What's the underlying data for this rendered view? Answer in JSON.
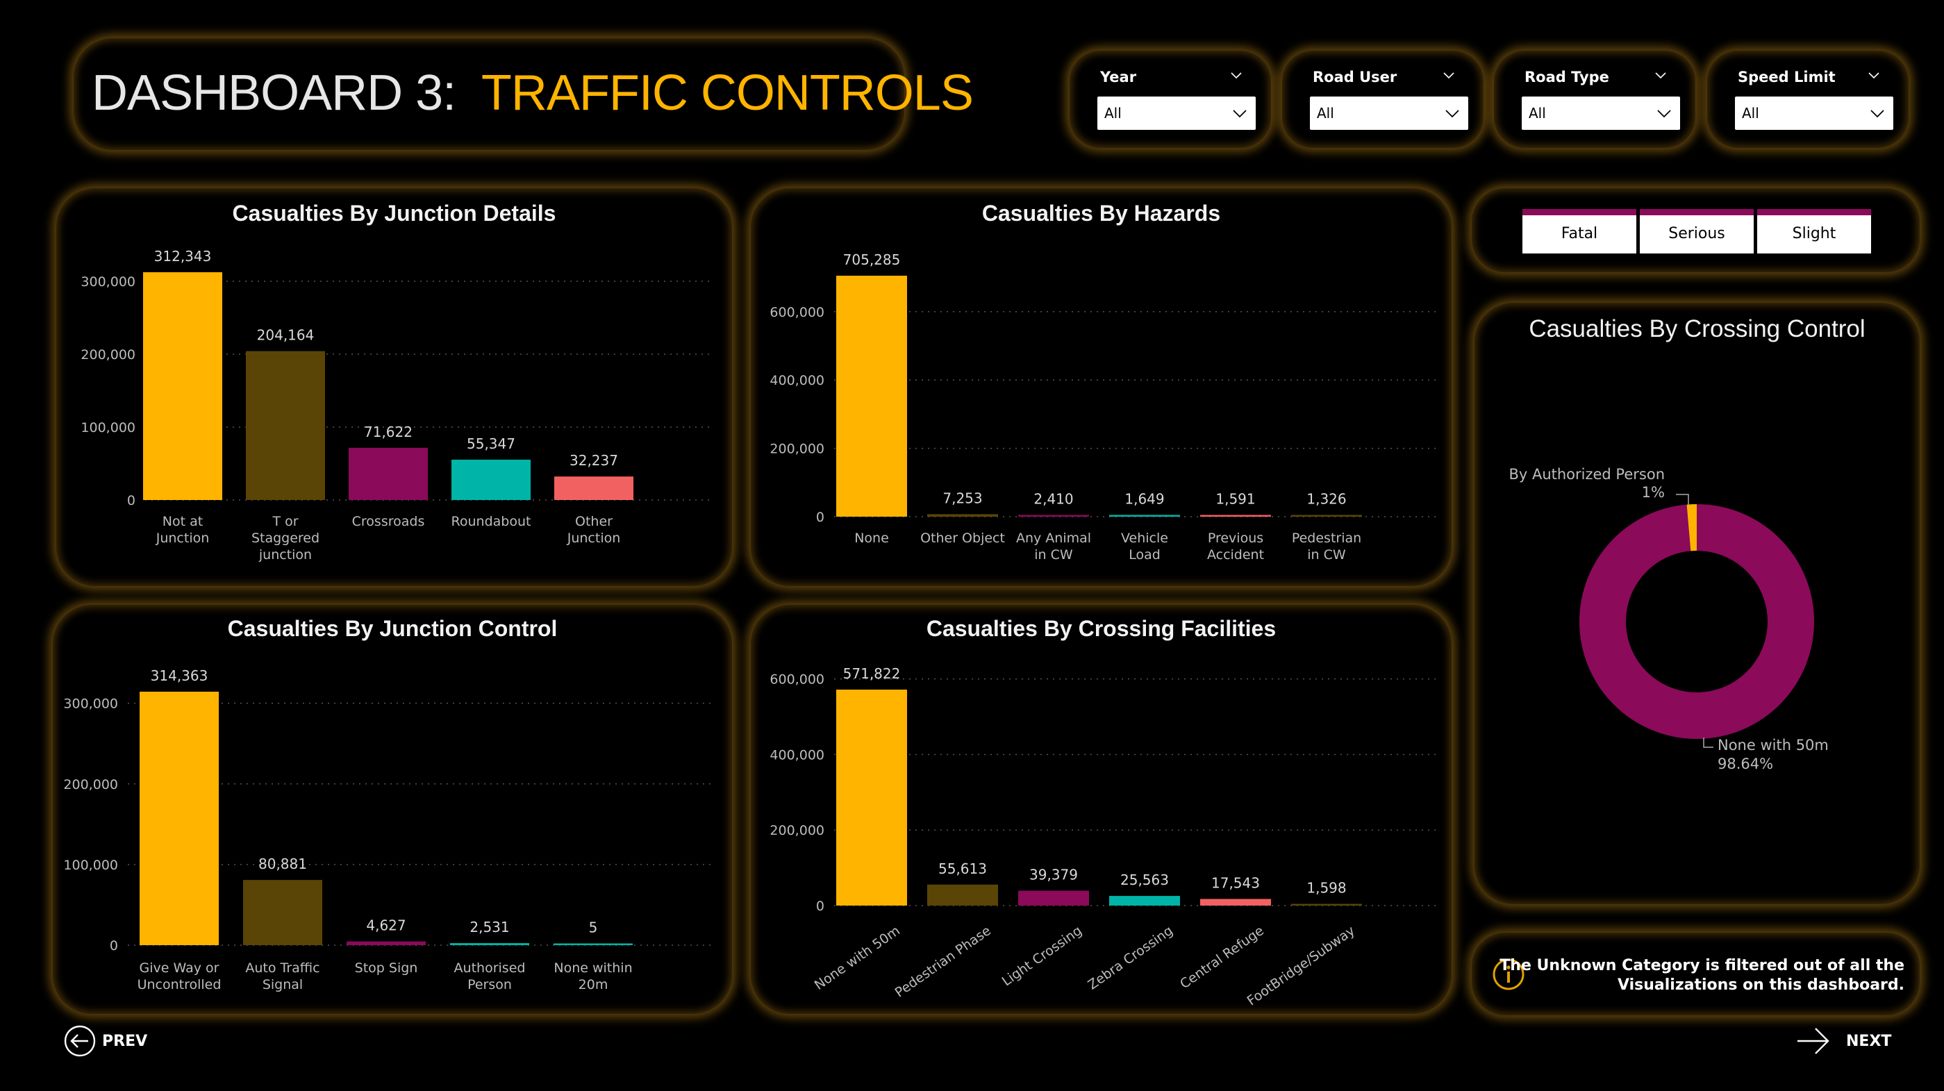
{
  "header": {
    "title_prefix": "DASHBOARD 3:",
    "title_main": "TRAFFIC CONTROLS"
  },
  "filters": [
    {
      "label": "Year",
      "value": "All"
    },
    {
      "label": "Road User",
      "value": "All"
    },
    {
      "label": "Road Type",
      "value": "All"
    },
    {
      "label": "Speed Limit",
      "value": "All"
    }
  ],
  "severity_buttons": [
    "Fatal",
    "Serious",
    "Slight"
  ],
  "info": {
    "line1": "The Unknown Category is filtered out of all the",
    "line2": "Visualizations on this dashboard."
  },
  "nav": {
    "prev": "PREV",
    "next": "NEXT"
  },
  "colors": {
    "yellow": "#ffb400",
    "brown": "#5a4406",
    "magenta": "#8b0a5a",
    "teal": "#00b5a7",
    "salmon": "#f26161",
    "accent_glow": "#aa7814"
  },
  "chart_data": [
    {
      "type": "bar",
      "title": "Casualties By Junction Details",
      "categories": [
        [
          "Not at",
          "Junction"
        ],
        [
          "T or",
          "Staggered",
          "junction"
        ],
        [
          "Crossroads"
        ],
        [
          "Roundabout"
        ],
        [
          "Other",
          "Junction"
        ]
      ],
      "values": [
        312343,
        204164,
        71622,
        55347,
        32237
      ],
      "value_labels": [
        "312,343",
        "204,164",
        "71,622",
        "55,347",
        "32,237"
      ],
      "colors": [
        "#ffb400",
        "#5a4406",
        "#8b0a5a",
        "#00b5a7",
        "#f26161"
      ],
      "yticks": [
        0,
        100000,
        200000,
        300000
      ],
      "ytick_labels": [
        "0",
        "100,000",
        "200,000",
        "300,000"
      ],
      "ylim": [
        0,
        312343
      ]
    },
    {
      "type": "bar",
      "title": "Casualties By Hazards",
      "categories": [
        [
          "None"
        ],
        [
          "Other Object"
        ],
        [
          "Any Animal",
          "in CW"
        ],
        [
          "Vehicle",
          "Load"
        ],
        [
          "Previous",
          "Accident"
        ],
        [
          "Pedestrian",
          "in CW"
        ]
      ],
      "values": [
        705285,
        7253,
        2410,
        1649,
        1591,
        1326
      ],
      "value_labels": [
        "705,285",
        "7,253",
        "2,410",
        "1,649",
        "1,591",
        "1,326"
      ],
      "colors": [
        "#ffb400",
        "#5a4406",
        "#8b0a5a",
        "#00b5a7",
        "#f26161",
        "#5a4406"
      ],
      "yticks": [
        0,
        200000,
        400000,
        600000
      ],
      "ytick_labels": [
        "0",
        "200,000",
        "400,000",
        "600,000"
      ],
      "ylim": [
        0,
        705285
      ]
    },
    {
      "type": "bar",
      "title": "Casualties By Junction Control",
      "categories": [
        [
          "Give Way or",
          "Uncontrolled"
        ],
        [
          "Auto Traffic",
          "Signal"
        ],
        [
          "Stop Sign"
        ],
        [
          "Authorised",
          "Person"
        ],
        [
          "None within",
          "20m"
        ]
      ],
      "values": [
        314363,
        80881,
        4627,
        2531,
        5
      ],
      "value_labels": [
        "314,363",
        "80,881",
        "4,627",
        "2,531",
        "5"
      ],
      "colors": [
        "#ffb400",
        "#5a4406",
        "#8b0a5a",
        "#00b5a7",
        "#00b5a7"
      ],
      "yticks": [
        0,
        100000,
        200000,
        300000
      ],
      "ytick_labels": [
        "0",
        "100,000",
        "200,000",
        "300,000"
      ],
      "ylim": [
        0,
        314363
      ]
    },
    {
      "type": "bar",
      "title": "Casualties By Crossing Facilities",
      "categories": [
        [
          "None with 50m"
        ],
        [
          "Pedestrian Phase"
        ],
        [
          "Light Crossing"
        ],
        [
          "Zebra Crossing"
        ],
        [
          "Central Refuge"
        ],
        [
          "FootBridge/Subway"
        ]
      ],
      "values": [
        571822,
        55613,
        39379,
        25563,
        17543,
        1598
      ],
      "value_labels": [
        "571,822",
        "55,613",
        "39,379",
        "25,563",
        "17,543",
        "1,598"
      ],
      "colors": [
        "#ffb400",
        "#5a4406",
        "#8b0a5a",
        "#00b5a7",
        "#f26161",
        "#5a4406"
      ],
      "yticks": [
        0,
        200000,
        400000,
        600000
      ],
      "ytick_labels": [
        "0",
        "200,000",
        "400,000",
        "600,000"
      ],
      "ylim": [
        0,
        571822
      ]
    },
    {
      "type": "pie",
      "title": "Casualties By Crossing Control",
      "slices": [
        {
          "label": "None with 50m",
          "percent_label": "98.64%",
          "value": 98.64,
          "color": "#8b0a5a"
        },
        {
          "label": "By Authorized Person",
          "percent_label": "1%",
          "value": 1.36,
          "color": "#ffb400"
        }
      ]
    }
  ]
}
